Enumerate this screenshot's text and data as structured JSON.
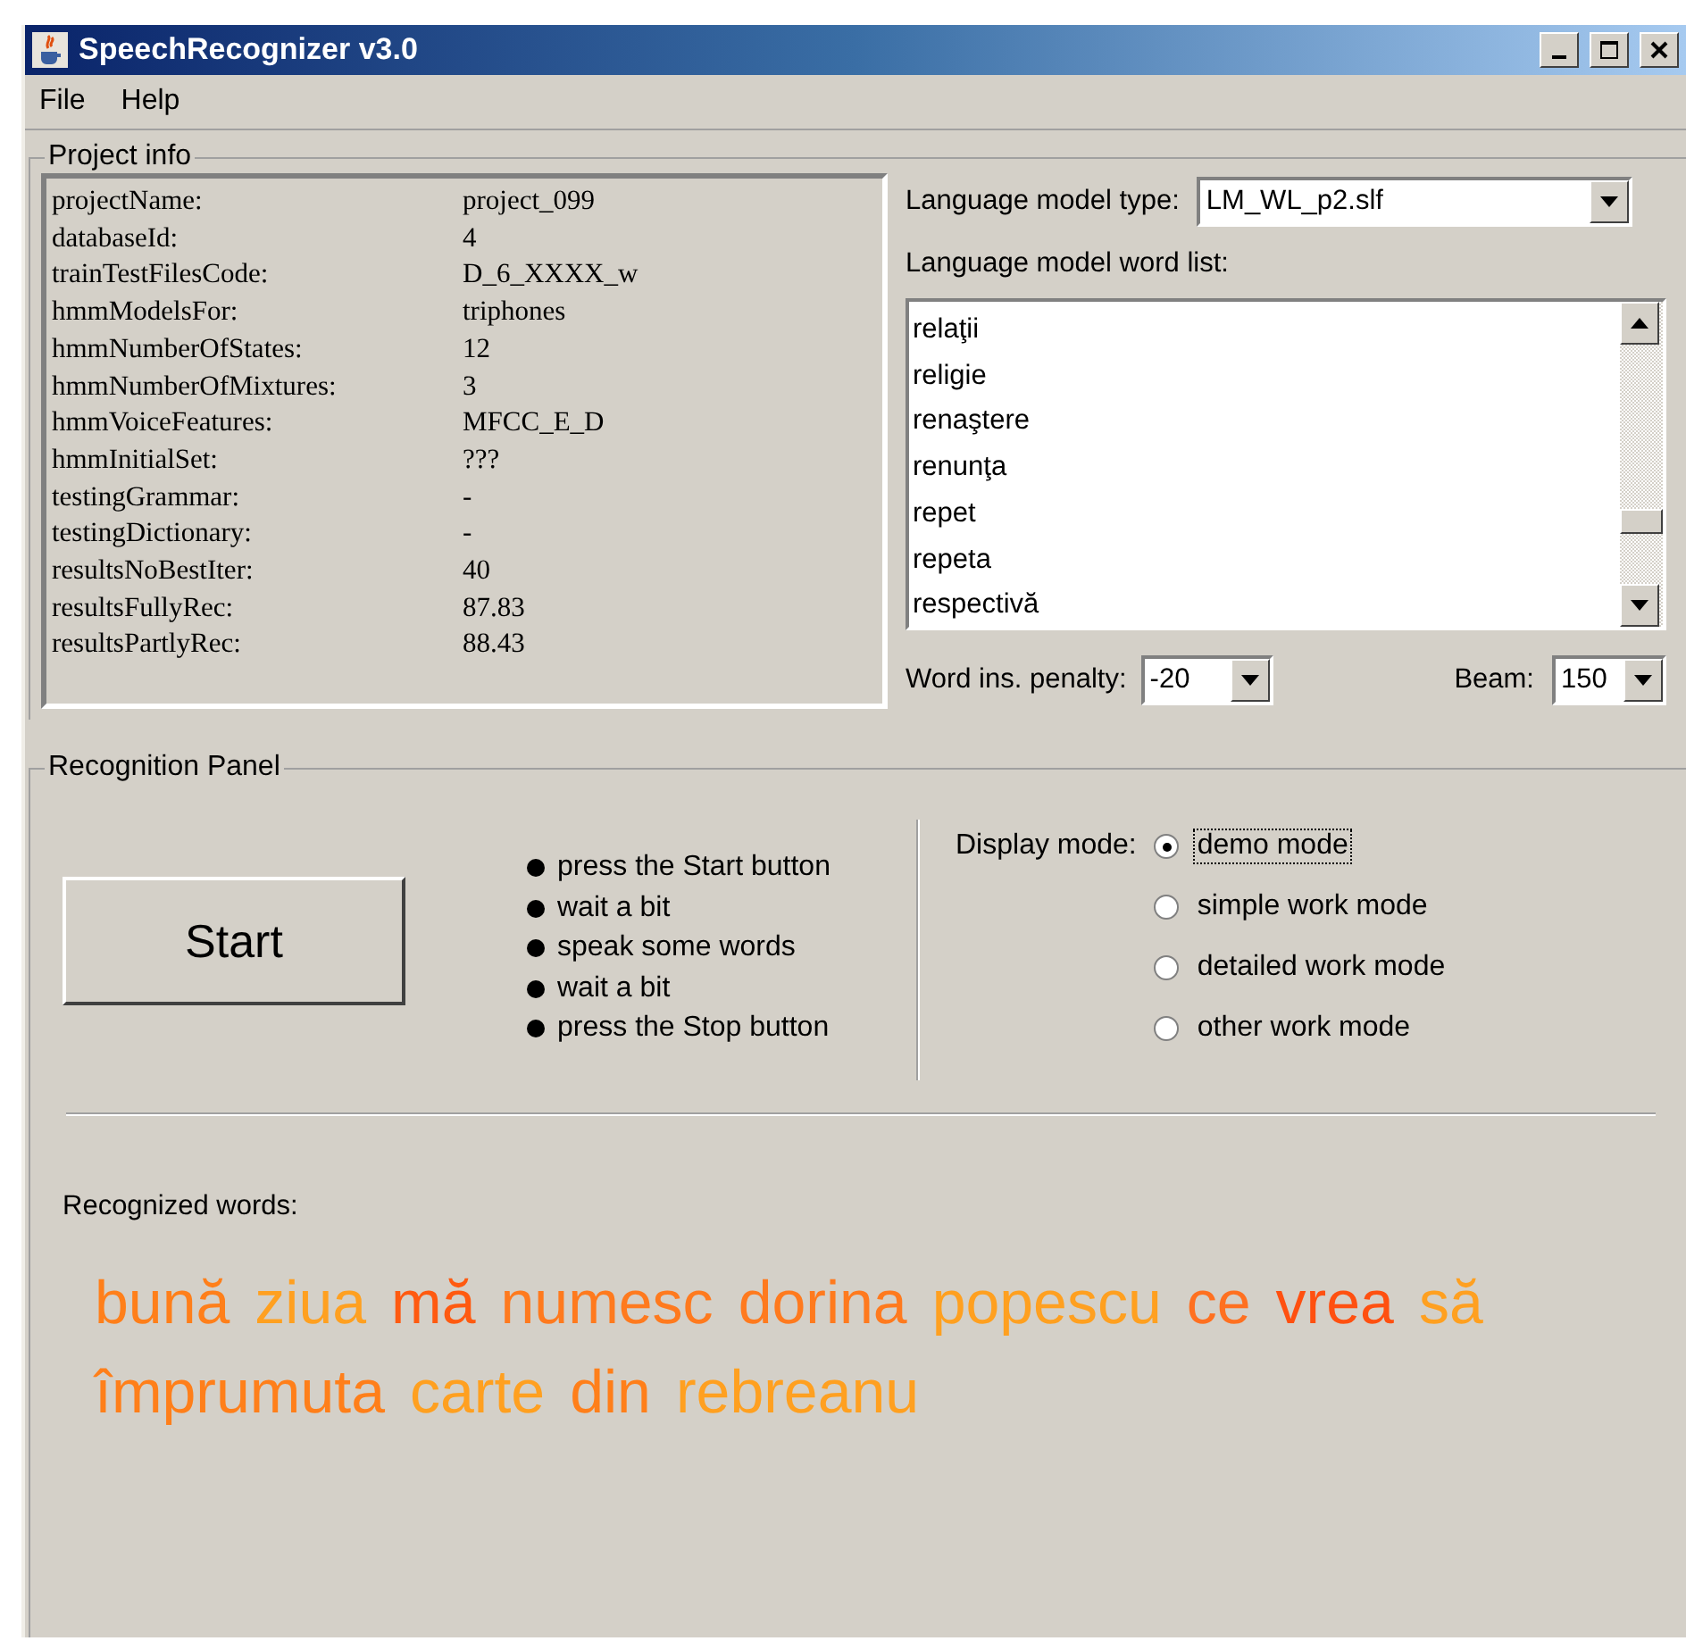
{
  "window": {
    "title": "SpeechRecognizer v3.0"
  },
  "menu": [
    "File",
    "Help"
  ],
  "project_info": {
    "title": "Project info",
    "properties": [
      {
        "name": "projectName:",
        "value": "project_099"
      },
      {
        "name": "databaseId:",
        "value": "4"
      },
      {
        "name": "trainTestFilesCode:",
        "value": "D_6_XXXX_w"
      },
      {
        "name": "hmmModelsFor:",
        "value": "triphones"
      },
      {
        "name": "hmmNumberOfStates:",
        "value": "12"
      },
      {
        "name": "hmmNumberOfMixtures:",
        "value": "3"
      },
      {
        "name": "hmmVoiceFeatures:",
        "value": "MFCC_E_D"
      },
      {
        "name": "hmmInitialSet:",
        "value": "???"
      },
      {
        "name": "testingGrammar:",
        "value": "-"
      },
      {
        "name": "testingDictionary:",
        "value": "-"
      },
      {
        "name": "resultsNoBestIter:",
        "value": "40"
      },
      {
        "name": "resultsFullyRec:",
        "value": "87.83"
      },
      {
        "name": "resultsPartlyRec:",
        "value": "88.43"
      }
    ],
    "language_model_type": {
      "label": "Language model type:",
      "value": "LM_WL_p2.slf"
    },
    "word_list": {
      "label": "Language model word list:",
      "items": [
        "relaţii",
        "religie",
        "renaştere",
        "renunţa",
        "repet",
        "repeta",
        "respectivă"
      ]
    },
    "word_ins_penalty": {
      "label": "Word ins. penalty:",
      "value": "-20"
    },
    "beam": {
      "label": "Beam:",
      "value": "150"
    }
  },
  "recognition_panel": {
    "title": "Recognition Panel",
    "start_button": "Start",
    "instructions": [
      "press the Start button",
      "wait a bit",
      "speak some words",
      "wait a bit",
      "press the Stop button"
    ],
    "display_mode": {
      "label": "Display mode:",
      "options": [
        {
          "label": "demo mode",
          "selected": true
        },
        {
          "label": "simple work mode",
          "selected": false
        },
        {
          "label": "detailed work mode",
          "selected": false
        },
        {
          "label": "other work mode",
          "selected": false
        }
      ]
    },
    "recognized_label": "Recognized words:",
    "recognized_words": [
      {
        "text": "bună",
        "color": "#ff7f1a"
      },
      {
        "text": "ziua",
        "color": "#ffa020"
      },
      {
        "text": "mă",
        "color": "#ff5a10"
      },
      {
        "text": "numesc",
        "color": "#ff7a1e"
      },
      {
        "text": "dorina",
        "color": "#ff7a1e"
      },
      {
        "text": "popescu",
        "color": "#ffa020"
      },
      {
        "text": "ce",
        "color": "#ff7020"
      },
      {
        "text": "vrea",
        "color": "#ff5010"
      },
      {
        "text": "să",
        "color": "#ffa020"
      },
      {
        "text": "împrumuta",
        "color": "#ff7f1a"
      },
      {
        "text": "carte",
        "color": "#ffa020"
      },
      {
        "text": "din",
        "color": "#ff7f1a"
      },
      {
        "text": "rebreanu",
        "color": "#ffa020"
      }
    ]
  }
}
